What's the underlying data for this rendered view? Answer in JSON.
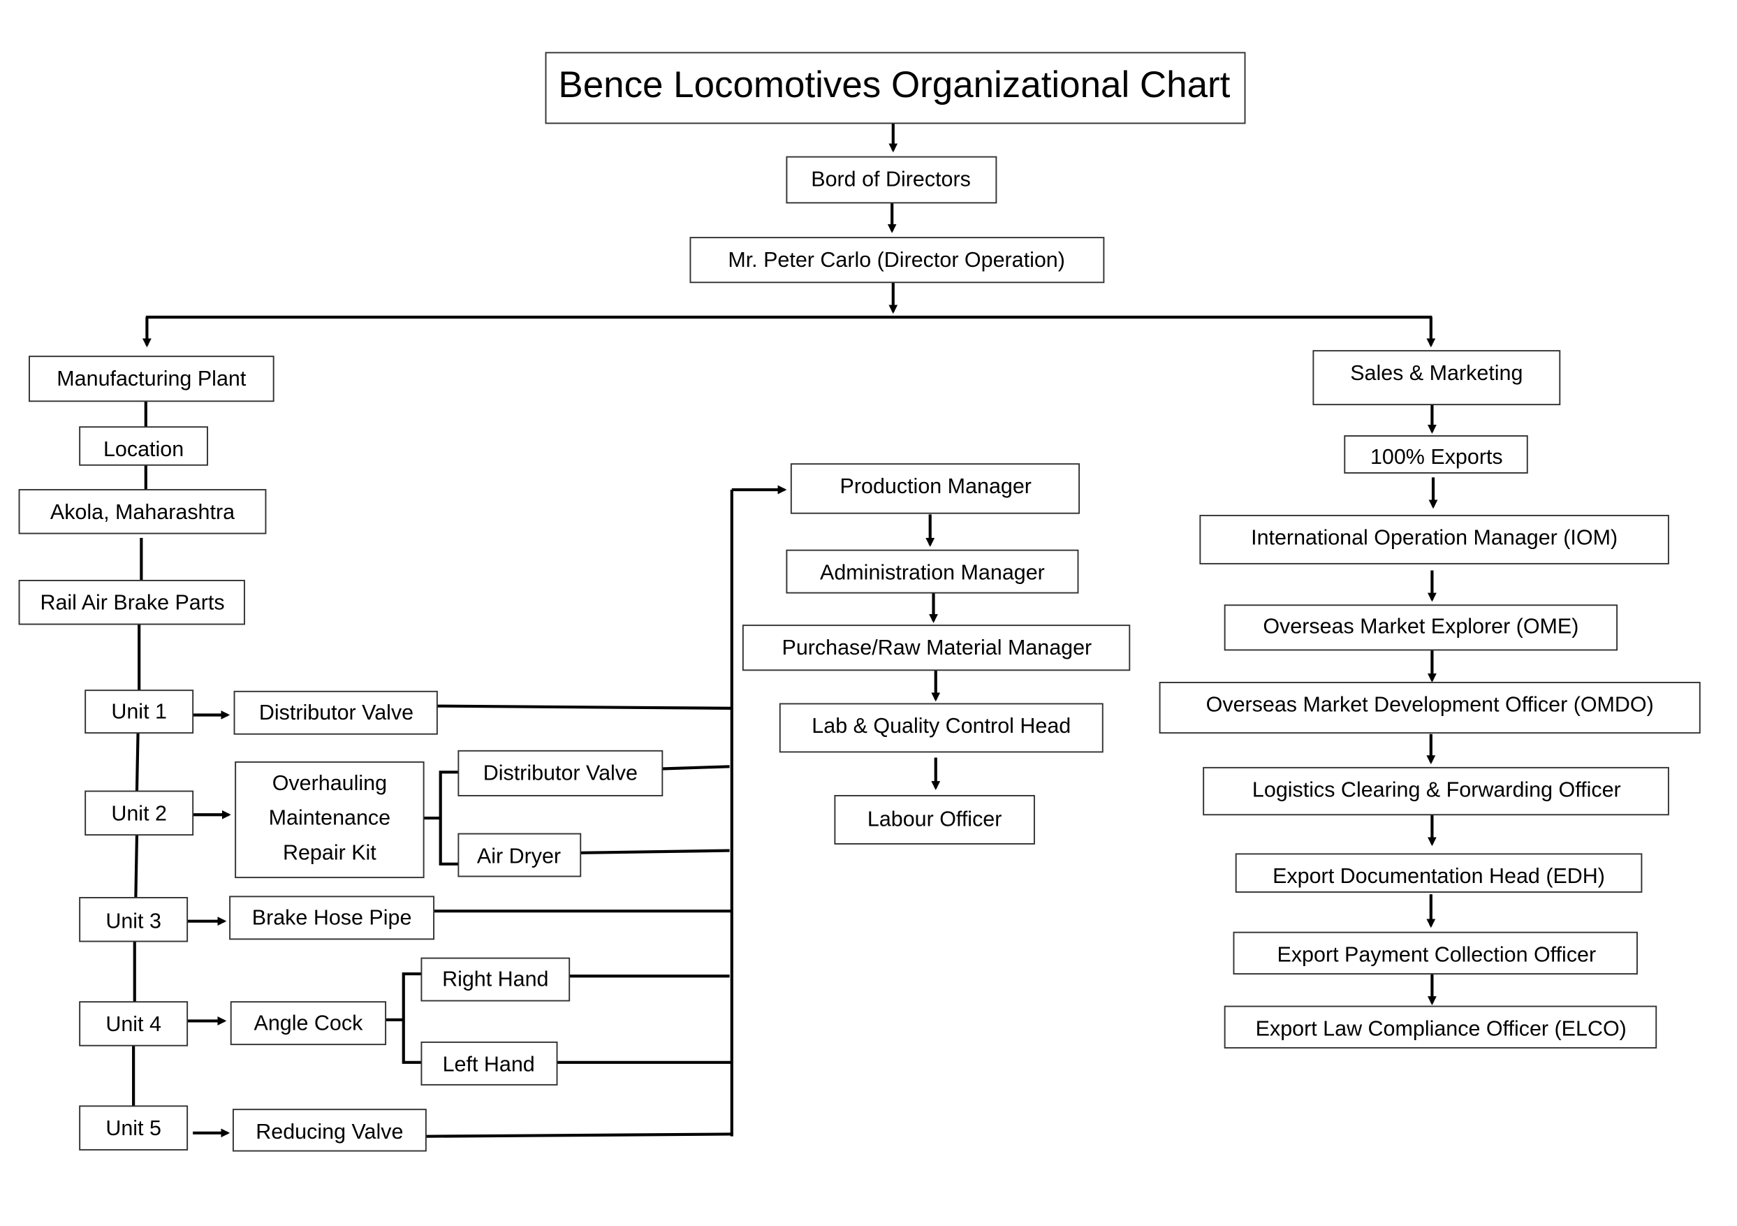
{
  "title": "Bence Locomotives Organizational Chart",
  "top": {
    "board": "Bord of Directors",
    "director": "Mr. Peter Carlo (Director Operation)"
  },
  "manufacturing": {
    "head": "Manufacturing Plant",
    "location_label": "Location",
    "location": "Akola, Maharashtra",
    "product": "Rail Air Brake Parts",
    "units": [
      {
        "name": "Unit 1",
        "part": "Distributor Valve"
      },
      {
        "name": "Unit 2",
        "part": "Overhauling Maintenance Repair Kit",
        "part_lines": [
          "Overhauling",
          "Maintenance",
          "Repair Kit"
        ],
        "subparts": [
          "Distributor Valve",
          "Air Dryer"
        ]
      },
      {
        "name": "Unit 3",
        "part": "Brake Hose Pipe"
      },
      {
        "name": "Unit 4",
        "part": "Angle Cock",
        "subparts": [
          "Right Hand",
          "Left Hand"
        ]
      },
      {
        "name": "Unit 5",
        "part": "Reducing Valve"
      }
    ]
  },
  "production": {
    "chain": [
      "Production Manager",
      "Administration Manager",
      "Purchase/Raw Material Manager",
      "Lab & Quality Control Head",
      "Labour Officer"
    ]
  },
  "sales": {
    "head": "Sales & Marketing",
    "exports": "100% Exports",
    "chain": [
      "International Operation Manager (IOM)",
      "Overseas Market Explorer (OME)",
      "Overseas Market Development Officer (OMDO)",
      "Logistics Clearing & Forwarding Officer",
      "Export Documentation Head (EDH)",
      "Export Payment Collection Officer",
      "Export Law Compliance Officer (ELCO)"
    ]
  }
}
